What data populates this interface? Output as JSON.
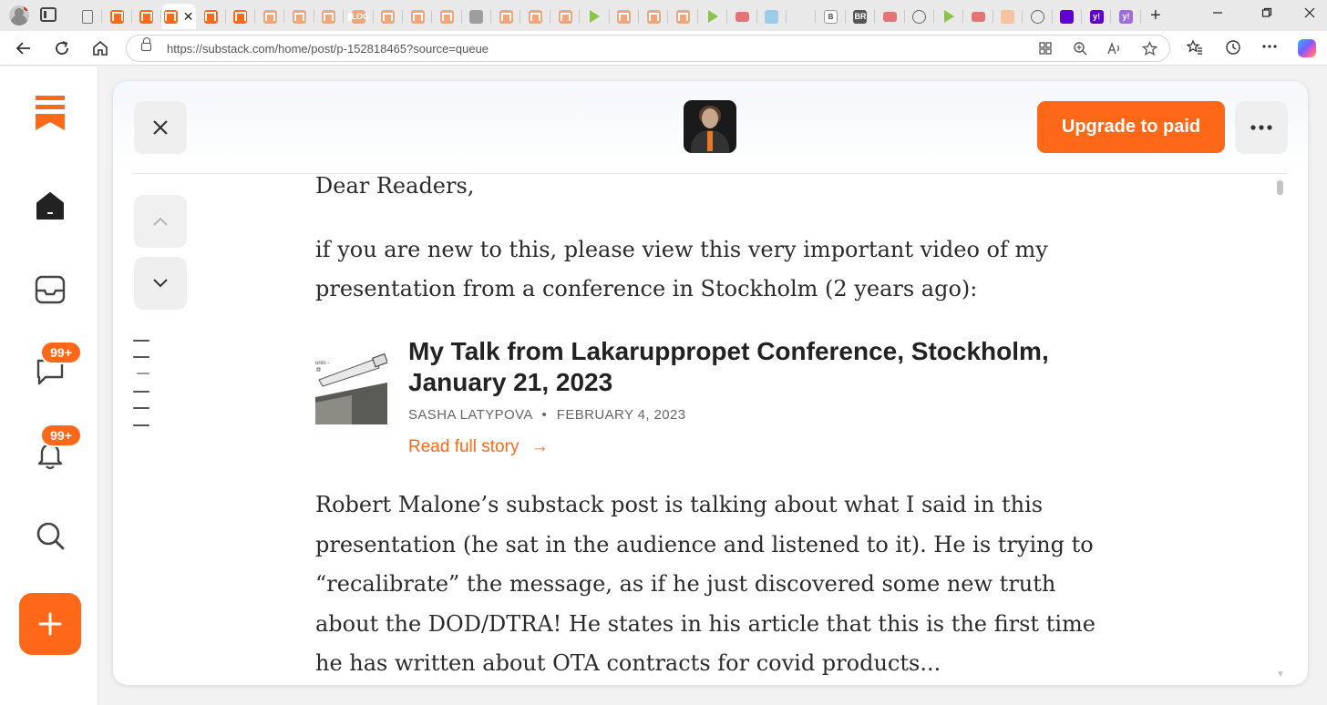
{
  "browser": {
    "url": "https://substack.com/home/post/p-152818465?source=queue",
    "tab_close_glyph": "✕",
    "new_tab_glyph": "+",
    "tabs": [
      {
        "kind": "doc"
      },
      {
        "kind": "ss"
      },
      {
        "kind": "ss"
      },
      {
        "kind": "ss",
        "active": true
      },
      {
        "kind": "ss"
      },
      {
        "kind": "ss"
      },
      {
        "kind": "ss-faded"
      },
      {
        "kind": "ss-faded"
      },
      {
        "kind": "ss-faded"
      },
      {
        "kind": "ss-faded",
        "text": "LOG"
      },
      {
        "kind": "ss-faded"
      },
      {
        "kind": "ss-faded"
      },
      {
        "kind": "ss-faded"
      },
      {
        "kind": "gray"
      },
      {
        "kind": "ss-faded"
      },
      {
        "kind": "ss-faded"
      },
      {
        "kind": "ss-faded"
      },
      {
        "kind": "play"
      },
      {
        "kind": "ss-faded"
      },
      {
        "kind": "ss-faded"
      },
      {
        "kind": "ss-faded"
      },
      {
        "kind": "play"
      },
      {
        "kind": "yt"
      },
      {
        "kind": "lightblue"
      },
      {
        "kind": "search"
      },
      {
        "kind": "book",
        "text": "B"
      },
      {
        "kind": "dark",
        "text": "BR"
      },
      {
        "kind": "yt"
      },
      {
        "kind": "ring"
      },
      {
        "kind": "play"
      },
      {
        "kind": "yt"
      },
      {
        "kind": "peach"
      },
      {
        "kind": "ring"
      },
      {
        "kind": "purple"
      },
      {
        "kind": "purple",
        "text": "y!"
      },
      {
        "kind": "purple-faded",
        "text": "y!"
      }
    ]
  },
  "rail": {
    "messages_badge": "99+",
    "notifications_badge": "99+",
    "compose_glyph": "+"
  },
  "reader": {
    "upgrade_label": "Upgrade to paid",
    "toc_lines": 6,
    "article": {
      "salutation": "Dear Readers,",
      "intro": "if you are new to this, please view this very important video of my presentation from a conference in Stockholm (2 years ago):",
      "embed": {
        "thumb_caption": "ures -",
        "title": "My Talk from Lakaruppropet Conference, Stockholm, January 21, 2023",
        "author": "SASHA LATYPOVA",
        "separator": "•",
        "date": "FEBRUARY 4, 2023",
        "read_more": "Read full story",
        "read_more_arrow": "→"
      },
      "body": "Robert Malone’s substack post is talking about what I said in this presentation (he sat in the audience and listened to it). He is trying to “recalibrate” the message, as if he just discovered some new truth about the DOD/DTRA! He states in his article that this is the first time he has written about OTA contracts for covid products..."
    }
  },
  "colors": {
    "brand": "#ff6719",
    "text": "#2b2b2b",
    "muted": "#666666"
  }
}
